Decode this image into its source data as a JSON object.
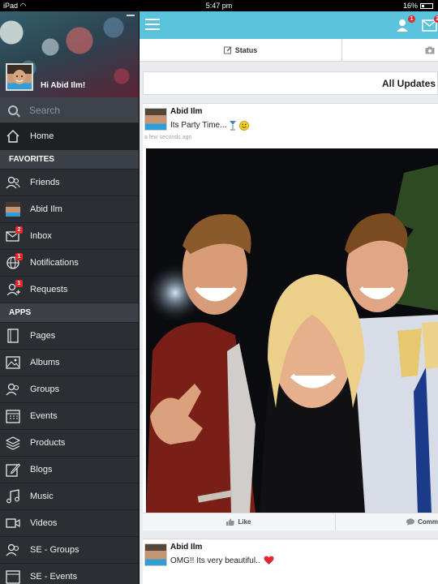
{
  "status_bar": {
    "device": "iPad",
    "time": "5:47 pm",
    "battery": "16%"
  },
  "sidebar": {
    "greeting": "Hi Abid Ilm!",
    "search_placeholder": "Search",
    "home_label": "Home",
    "favorites_title": "FAVORITES",
    "favorites": [
      {
        "label": "Friends",
        "icon": "friends-icon",
        "badge": ""
      },
      {
        "label": "Abid Ilm",
        "icon": "avatar-icon",
        "badge": ""
      },
      {
        "label": "Inbox",
        "icon": "inbox-icon",
        "badge": "2"
      },
      {
        "label": "Notifications",
        "icon": "globe-icon",
        "badge": "1"
      },
      {
        "label": "Requests",
        "icon": "add-user-icon",
        "badge": "1"
      }
    ],
    "apps_title": "APPS",
    "apps": [
      {
        "label": "Pages",
        "icon": "page-icon"
      },
      {
        "label": "Albums",
        "icon": "album-icon"
      },
      {
        "label": "Groups",
        "icon": "groups-icon"
      },
      {
        "label": "Events",
        "icon": "calendar-icon"
      },
      {
        "label": "Products",
        "icon": "layers-icon"
      },
      {
        "label": "Blogs",
        "icon": "edit-icon"
      },
      {
        "label": "Music",
        "icon": "music-icon"
      },
      {
        "label": "Videos",
        "icon": "video-icon"
      },
      {
        "label": "SE - Groups",
        "icon": "groups-icon"
      },
      {
        "label": "SE - Events",
        "icon": "calendar-icon"
      }
    ]
  },
  "topbar": {
    "friend_requests_badge": "1",
    "messages_badge": "2",
    "accent": "#5bc2dc"
  },
  "tabs": {
    "status_label": "Status"
  },
  "feed": {
    "header": "All Updates",
    "posts": [
      {
        "author": "Abid Ilm",
        "text": "Its Party Time...",
        "time": "a few seconds ago"
      },
      {
        "author": "Abid Ilm",
        "text": "OMG!! Its very beautiful.."
      }
    ],
    "like_label": "Like",
    "comment_label": "Comm"
  }
}
